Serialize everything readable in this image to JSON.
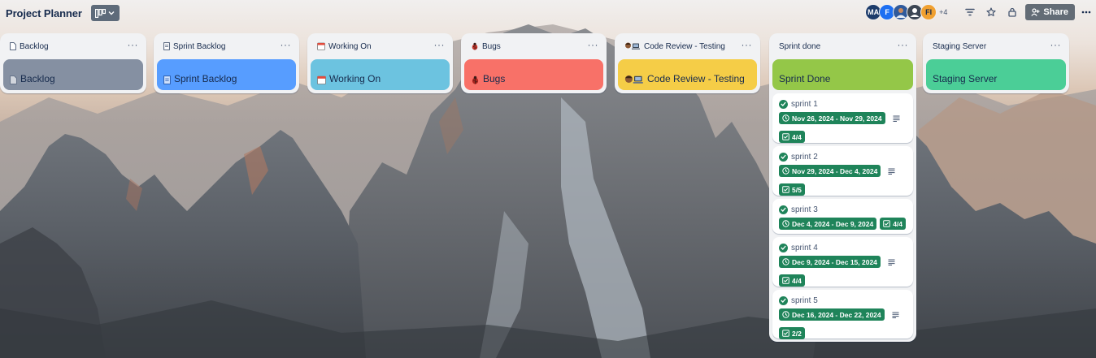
{
  "board": {
    "title": "Project Planner",
    "members": [
      "MA",
      "F",
      "",
      "",
      "FI"
    ],
    "more_members": "+4",
    "share_label": "Share"
  },
  "lists": [
    {
      "id": "backlog",
      "title": "Backlog",
      "emoji": "📄",
      "cover_color": "#8590a2",
      "cover_label": "Backlog"
    },
    {
      "id": "sprint-backlog",
      "title": "Sprint Backlog",
      "emoji": "🧾",
      "cover_color": "#579dff",
      "cover_label": "Sprint Backlog"
    },
    {
      "id": "working-on",
      "title": "Working On",
      "emoji": "📅",
      "cover_color": "#6cc3e0",
      "cover_label": "Working On"
    },
    {
      "id": "bugs",
      "title": "Bugs",
      "emoji": "🐞",
      "cover_color": "#f87168",
      "cover_label": "Bugs"
    },
    {
      "id": "code-review",
      "title": "Code Review - Testing",
      "emoji": "🧑🏾💻",
      "cover_color": "#f5cd47",
      "cover_label": "Code Review - Testing"
    },
    {
      "id": "sprint-done",
      "title": "Sprint done",
      "emoji": "",
      "cover_color": "#94c748",
      "cover_label": "Sprint Done"
    },
    {
      "id": "staging",
      "title": "Staging Server",
      "emoji": "",
      "cover_color": "#4bce97",
      "cover_label": "Staging Server"
    }
  ],
  "sprint_cards": [
    {
      "title": "sprint 1",
      "dates": "Nov 26, 2024 - Nov 29, 2024",
      "checklist": "4/4",
      "has_description": true
    },
    {
      "title": "sprint 2",
      "dates": "Nov 29, 2024 - Dec 4, 2024",
      "checklist": "5/5",
      "has_description": true
    },
    {
      "title": "sprint 3",
      "dates": "Dec 4, 2024 - Dec 9, 2024",
      "checklist": "4/4",
      "has_description": false
    },
    {
      "title": "sprint 4",
      "dates": "Dec 9, 2024 - Dec 15, 2024",
      "checklist": "4/4",
      "has_description": true
    },
    {
      "title": "sprint 5",
      "dates": "Dec 16, 2024 - Dec 22, 2024",
      "checklist": "2/2",
      "has_description": true
    }
  ],
  "colors": {
    "badge_green": "#1f845a",
    "list_bg": "#f1f2f4"
  }
}
